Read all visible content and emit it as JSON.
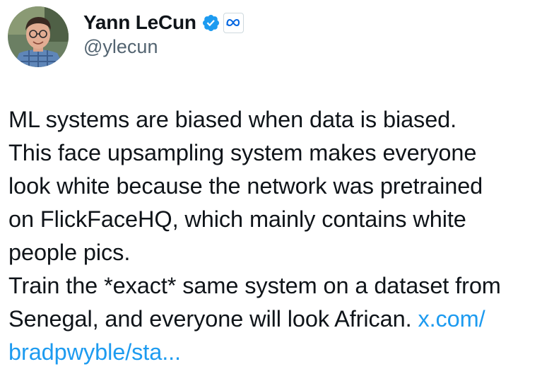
{
  "author": {
    "display_name": "Yann LeCun",
    "handle": "@ylecun",
    "verified": true,
    "affiliation_icon": "meta-logo-icon",
    "avatar_icon": "profile-photo"
  },
  "tweet": {
    "lines": [
      "ML systems are biased when data is biased.",
      "This face upsampling system makes everyone",
      "look white because the network was pretrained",
      "on FlickFaceHQ, which mainly contains white",
      "people pics.",
      "Train the *exact* same system on a dataset from"
    ],
    "last_line_text": "Senegal, and everyone will look African. ",
    "link_part1": "x.com/",
    "link_part2": "bradpwyble/sta..."
  },
  "colors": {
    "text": "#0f1419",
    "secondary": "#536471",
    "link": "#1d9bf0",
    "verified_badge": "#1d9bf0",
    "meta_logo": "#0668e1"
  }
}
